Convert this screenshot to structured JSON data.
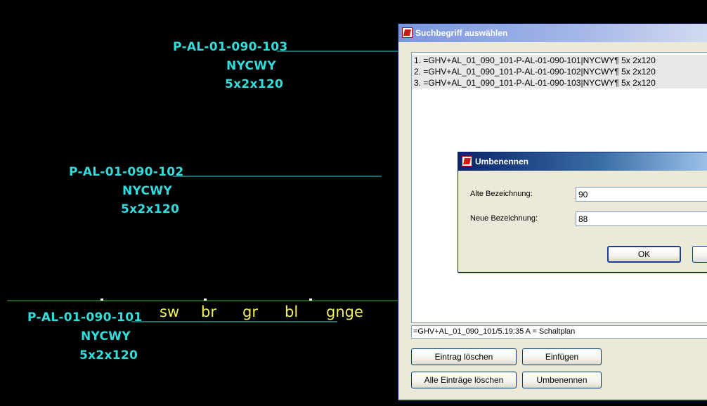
{
  "cad": {
    "line_color": "#33dcdc",
    "core_color": "#f0f060",
    "cables": [
      {
        "id": "P-AL-01-090-103",
        "type": "NYCWY",
        "size": "5x2x120"
      },
      {
        "id": "P-AL-01-090-102",
        "type": "NYCWY",
        "size": "5x2x120"
      },
      {
        "id": "P-AL-01-090-101",
        "type": "NYCWY",
        "size": "5x2x120"
      }
    ],
    "cores": [
      "sw",
      "br",
      "gr",
      "bl",
      "gnge"
    ]
  },
  "search_dialog": {
    "title": "Suchbegriff auswählen",
    "items": [
      "1. =GHV+AL_01_090_101-P-AL-01-090-101|NYCWY¶ 5x 2x120",
      "2. =GHV+AL_01_090_101-P-AL-01-090-102|NYCWY¶ 5x 2x120",
      "3. =GHV+AL_01_090_101-P-AL-01-090-103|NYCWY¶ 5x 2x120"
    ],
    "status": "=GHV+AL_01_090_101/5.19:35 A = Schaltplan",
    "buttons": {
      "delete_entry": "Eintrag löschen",
      "insert": "Einfügen",
      "delete_all": "Alle Einträge löschen",
      "rename": "Umbenennen"
    }
  },
  "rename_dialog": {
    "title": "Umbenennen",
    "old_label": "Alte Bezeichnung:",
    "old_value": "90",
    "new_label": "Neue Bezeichnung:",
    "new_value": "88",
    "ok_label": "OK"
  }
}
